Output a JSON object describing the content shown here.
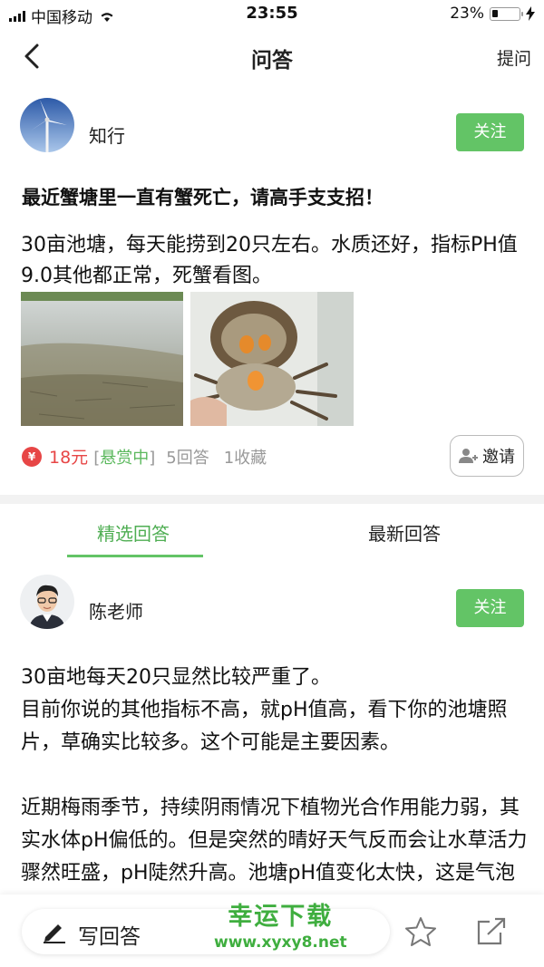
{
  "status_bar": {
    "carrier": "中国移动",
    "time": "23:55",
    "battery": "23%",
    "battery_level": 0.23
  },
  "nav": {
    "title": "问答",
    "ask_label": "提问"
  },
  "question": {
    "author": "知行",
    "follow_label": "关注",
    "title": "最近蟹塘里一直有蟹死亡，请高手支支招！",
    "body": "30亩池塘，每天能捞到20只左右。水质还好，指标PH值9.0其他都正常，死蟹看图。",
    "coin_symbol": "¥",
    "reward": "18元",
    "status_open": "[",
    "status_text": "悬赏中",
    "status_close": "]",
    "answer_count": "5回答",
    "favorite_count": "1收藏",
    "invite_label": "邀请"
  },
  "tabs": [
    {
      "label": "精选回答"
    },
    {
      "label": "最新回答"
    }
  ],
  "answer": {
    "author": "陈老师",
    "follow_label": "关注",
    "paragraphs": [
      "30亩地每天20只显然比较严重了。",
      "目前你说的其他指标不高，就pH值高，看下你的池塘照片，草确实比较多。这个可能是主要因素。",
      "",
      "近期梅雨季节，持续阴雨情况下植物光合作用能力弱，其实水体pH偏低的。但是突然的晴好天气反而会让水草活力骤然旺盛，pH陡然升高。池塘pH值变化太快，这是气泡病发生之一，所以这会时候出"
    ]
  },
  "bottom_bar": {
    "write_label": "写回答",
    "watermark_title": "幸运下载",
    "watermark_url": "www.xyxy8.net"
  },
  "colors": {
    "accent_green": "#63c466",
    "reward_red": "#e74646"
  }
}
